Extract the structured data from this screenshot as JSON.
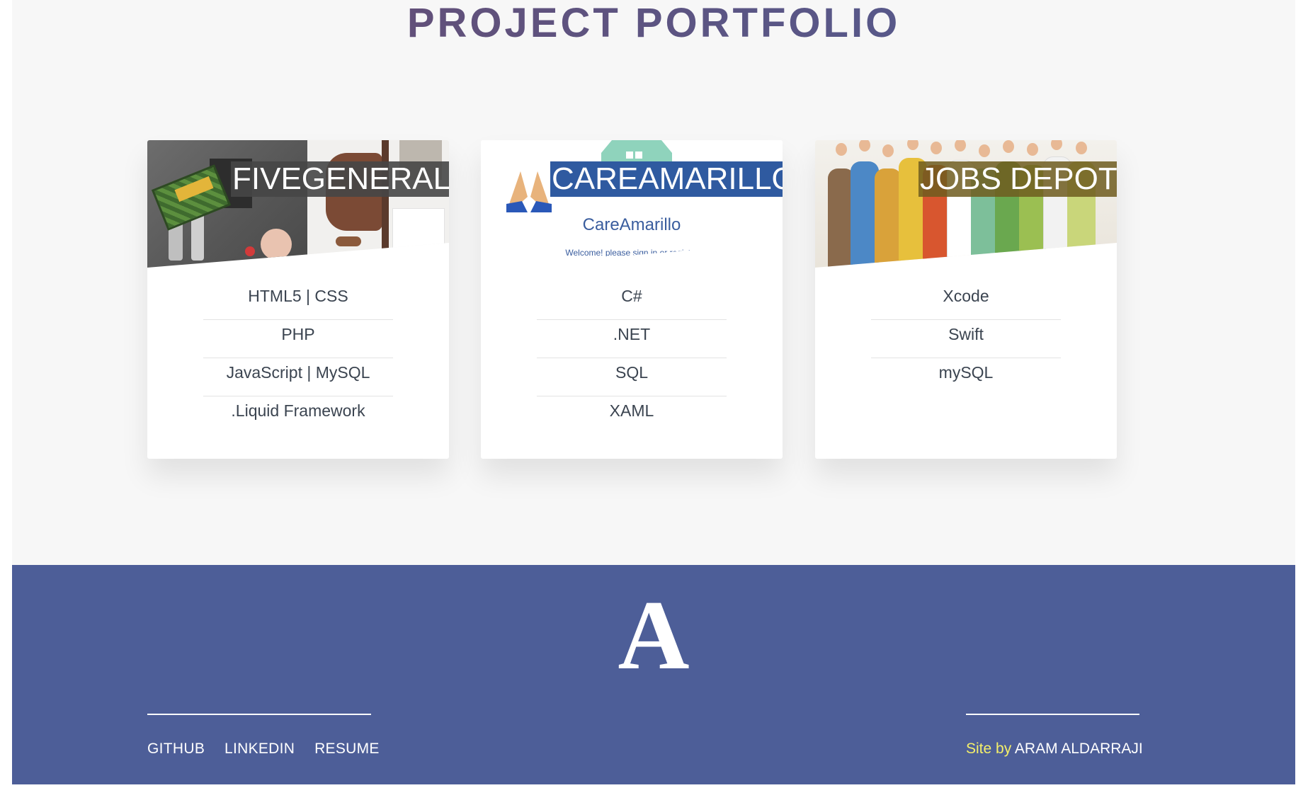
{
  "page": {
    "title": "PROJECT PORTFOLIO"
  },
  "projects": [
    {
      "name": "FIVEGENERAL",
      "techs": [
        "HTML5 | CSS",
        "PHP",
        "JavaScript | MySQL",
        ".Liquid Framework"
      ]
    },
    {
      "name": "CAREAMARILLO",
      "image_text": "CareAmarillo",
      "image_subtext": "Welcome! please sign in or register",
      "techs": [
        "C#",
        ".NET",
        "SQL",
        "XAML"
      ]
    },
    {
      "name": "JOBS DEPOT",
      "techs": [
        "Xcode",
        "Swift",
        "mySQL"
      ]
    }
  ],
  "footer": {
    "logo": "A",
    "links": [
      "GITHUB",
      "LINKEDIN",
      "RESUME"
    ],
    "credit_prefix": "Site by",
    "credit_name": "ARAM ALDARRAJI"
  },
  "colors": {
    "footer_bg": "#4d5e98",
    "title_gradient_start": "#6a4a6d",
    "title_gradient_end": "#4f5e96",
    "credit_accent": "#f4ef6a",
    "careamarillo_title_bg": "#2f5aa0",
    "fivegeneral_title_bg": "#4a4a4a",
    "jobsdepot_title_bg": "#7a6a2a"
  }
}
